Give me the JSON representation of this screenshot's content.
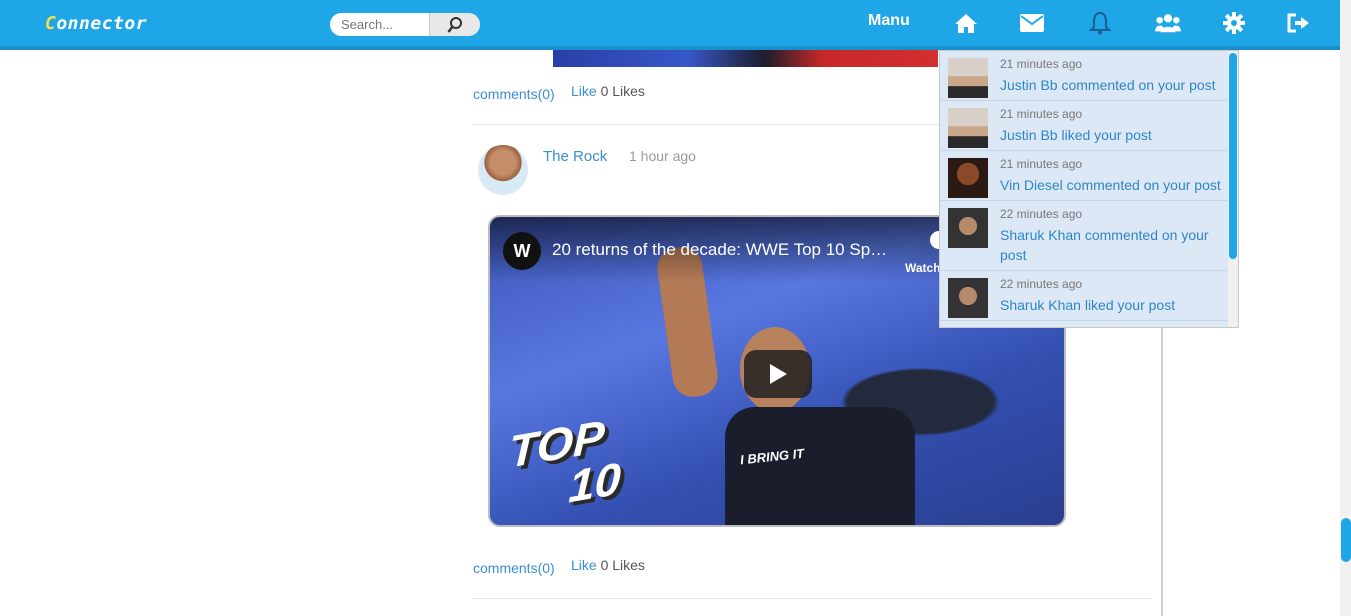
{
  "navbar": {
    "logo_first": "C",
    "logo_rest": "onnector",
    "search_placeholder": "Search...",
    "menu_label": "Manu",
    "icons": [
      "home-icon",
      "mail-icon",
      "bell-icon",
      "friends-icon",
      "gear-icon",
      "logout-icon"
    ]
  },
  "feed": {
    "prev_post": {
      "comments": "comments(0)",
      "like": "Like",
      "likes": "0 Likes"
    },
    "post": {
      "author": "The Rock",
      "time": "1 hour ago",
      "video_title": "20 returns of the decade: WWE Top 10 Sp…",
      "watch_later": "Watch",
      "top10_line1": "TOP",
      "top10_line2": "10",
      "shirt_text": "I BRING IT",
      "comments": "comments(0)",
      "like": "Like",
      "likes": "0 Likes"
    }
  },
  "notifications": [
    {
      "time": "21 minutes ago",
      "text": "Justin Bb commented on your post",
      "avatar": "justin"
    },
    {
      "time": "21 minutes ago",
      "text": "Justin Bb liked your post",
      "avatar": "justin"
    },
    {
      "time": "21 minutes ago",
      "text": "Vin Diesel commented on your post",
      "avatar": "vin"
    },
    {
      "time": "22 minutes ago",
      "text": "Sharuk Khan commented on your post",
      "avatar": "sharuk"
    },
    {
      "time": "22 minutes ago",
      "text": "Sharuk Khan liked your post",
      "avatar": "sharuk"
    }
  ],
  "colors": {
    "brand": "#1fa6e6",
    "link": "#3a8fd1",
    "notif_bg": "#dde8f6"
  }
}
